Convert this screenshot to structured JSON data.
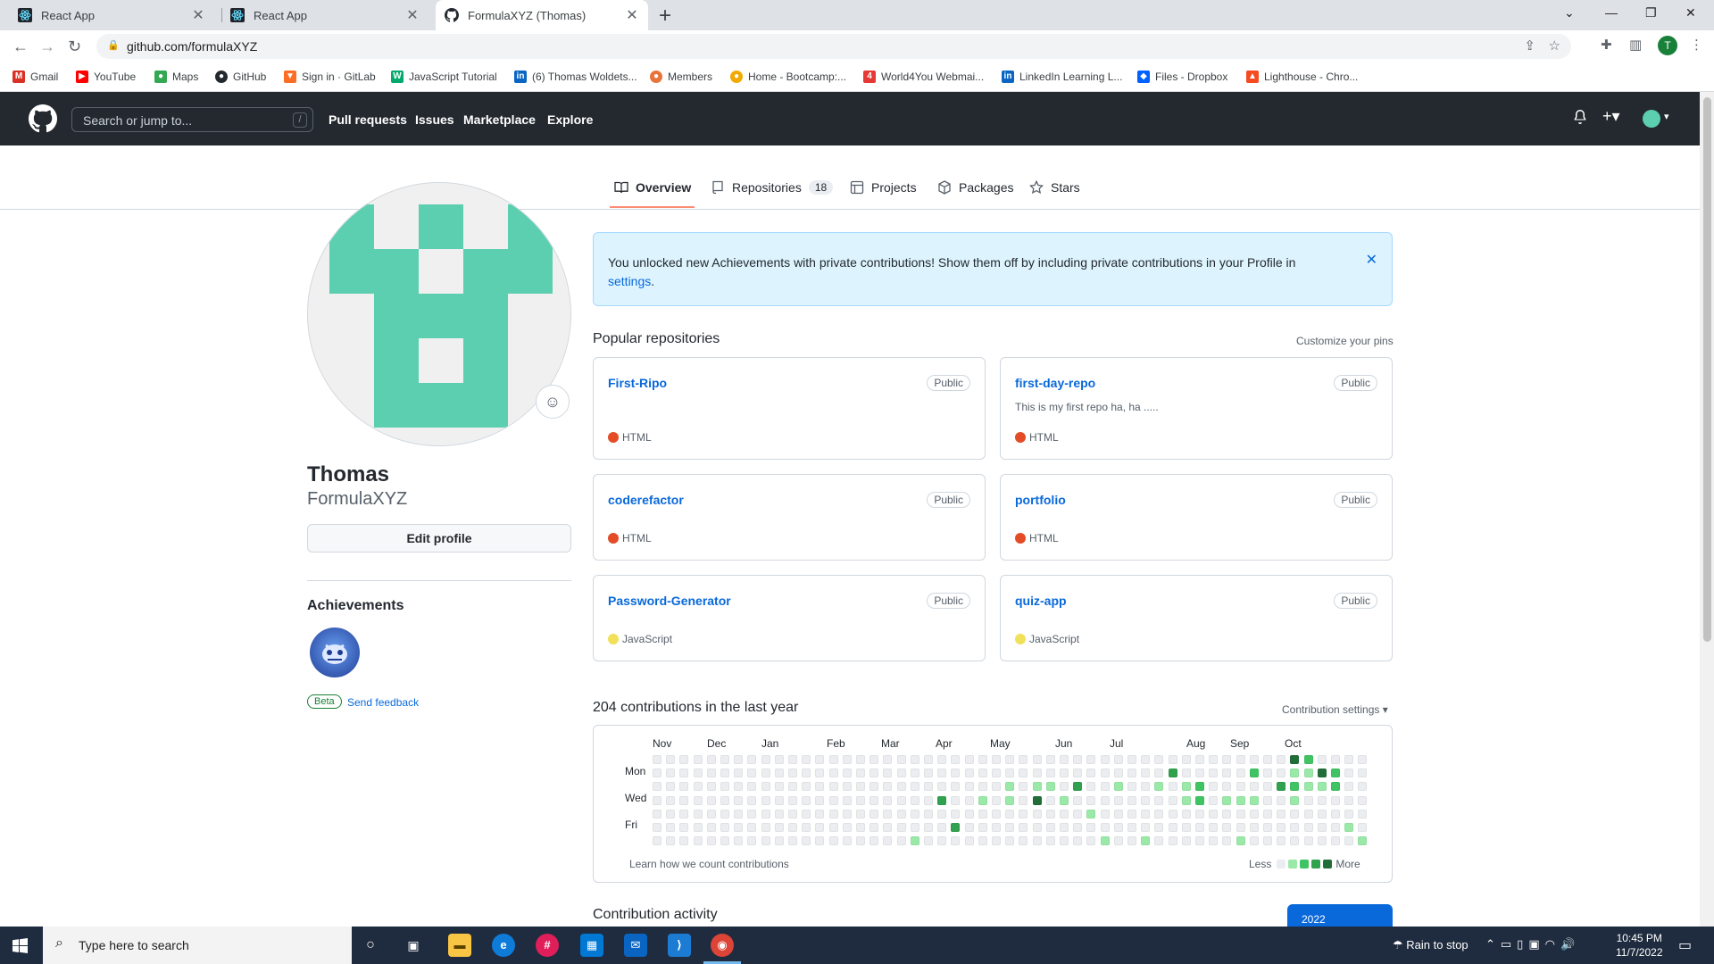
{
  "browser": {
    "tabs": [
      {
        "title": "React App",
        "active": false
      },
      {
        "title": "React App",
        "active": false
      },
      {
        "title": "FormulaXYZ (Thomas)",
        "active": true
      }
    ],
    "url": "github.com/formulaXYZ",
    "profile_initial": "T",
    "bookmarks": [
      {
        "label": "Gmail",
        "icon": "gmail-icon",
        "color": "#d93025"
      },
      {
        "label": "YouTube",
        "icon": "youtube-icon",
        "color": "#ff0000"
      },
      {
        "label": "Maps",
        "icon": "maps-icon",
        "color": "#34a853"
      },
      {
        "label": "GitHub",
        "icon": "github-icon",
        "color": "#24292f"
      },
      {
        "label": "Sign in · GitLab",
        "icon": "gitlab-icon",
        "color": "#fc6d26"
      },
      {
        "label": "JavaScript Tutorial",
        "icon": "w3schools-icon",
        "color": "#04aa6d"
      },
      {
        "label": "(6) Thomas Woldets...",
        "icon": "linkedin-icon",
        "color": "#0a66c2"
      },
      {
        "label": "Members",
        "icon": "members-icon",
        "color": "#e8743b"
      },
      {
        "label": "Home - Bootcamp:...",
        "icon": "bootcamp-icon",
        "color": "#f2a900"
      },
      {
        "label": "World4You Webmai...",
        "icon": "world4you-icon",
        "color": "#e53935"
      },
      {
        "label": "LinkedIn Learning L...",
        "icon": "linkedin-icon",
        "color": "#0a66c2"
      },
      {
        "label": "Files - Dropbox",
        "icon": "dropbox-icon",
        "color": "#0061fe"
      },
      {
        "label": "Lighthouse - Chro...",
        "icon": "lighthouse-icon",
        "color": "#f44b21"
      }
    ]
  },
  "github": {
    "search_placeholder": "Search or jump to...",
    "search_shortcut": "/",
    "nav": [
      "Pull requests",
      "Issues",
      "Marketplace",
      "Explore"
    ],
    "profile_tabs": {
      "overview": "Overview",
      "repositories": "Repositories",
      "repositories_count": "18",
      "projects": "Projects",
      "packages": "Packages",
      "stars": "Stars"
    },
    "profile": {
      "name": "Thomas",
      "login": "FormulaXYZ",
      "edit_button": "Edit profile",
      "achievements_title": "Achievements",
      "beta": "Beta",
      "feedback": "Send feedback",
      "avatar_color": "#5ccfb0"
    },
    "flash": {
      "text": "You unlocked new Achievements with private contributions! Show them off by including private contributions in your Profile in",
      "link": "settings",
      "period": "."
    },
    "popular": {
      "title": "Popular repositories",
      "customize": "Customize your pins",
      "repos": [
        {
          "name": "First-Ripo",
          "visibility": "Public",
          "description": "",
          "language": "HTML",
          "lang_color": "#e34c26"
        },
        {
          "name": "first-day-repo",
          "visibility": "Public",
          "description": "This is my first repo ha, ha .....",
          "language": "HTML",
          "lang_color": "#e34c26"
        },
        {
          "name": "coderefactor",
          "visibility": "Public",
          "description": "",
          "language": "HTML",
          "lang_color": "#e34c26"
        },
        {
          "name": "portfolio",
          "visibility": "Public",
          "description": "",
          "language": "HTML",
          "lang_color": "#e34c26"
        },
        {
          "name": "Password-Generator",
          "visibility": "Public",
          "description": "",
          "language": "JavaScript",
          "lang_color": "#f1e05a"
        },
        {
          "name": "quiz-app",
          "visibility": "Public",
          "description": "",
          "language": "JavaScript",
          "lang_color": "#f1e05a"
        }
      ]
    },
    "contributions": {
      "title": "204 contributions in the last year",
      "settings": "Contribution settings ▾",
      "months": [
        "Nov",
        "Dec",
        "Jan",
        "Feb",
        "Mar",
        "Apr",
        "May",
        "Jun",
        "Jul",
        "Aug",
        "Sep",
        "Oct"
      ],
      "days": [
        "Mon",
        "Wed",
        "Fri"
      ],
      "learn": "Learn how we count contributions",
      "less": "Less",
      "more": "More",
      "level_colors": [
        "#ebedf0",
        "#9be9a8",
        "#40c463",
        "#30a14e",
        "#216e39"
      ],
      "levels_by_week": [
        "0000000",
        "0000000",
        "0000000",
        "0000000",
        "0000000",
        "0000000",
        "0000000",
        "0000000",
        "0000000",
        "0000000",
        "0000000",
        "0000000",
        "0000000",
        "0000000",
        "0000000",
        "0000000",
        "0000000",
        "0000000",
        "0000000",
        "0000000",
        "0000000",
        "0000000",
        "0000000",
        "0000000",
        "0000000",
        "0000000",
        "0000000",
        "0000000",
        "0000000",
        "0000000",
        "0000001",
        "0000000",
        "0003000",
        "0000030",
        "0000000",
        "0001000",
        "0000000",
        "0000000",
        "0000000",
        "0000000",
        "0000000",
        "0100000",
        "0000000",
        "0000000",
        "0000000",
        "0000000",
        "0000000",
        "0000000",
        "0000000",
        "0000000",
        "0000000",
        "0000000",
        "0000000",
        "0000000",
        "0000000",
        "0000000",
        "0000000",
        "0000000",
        "0000000",
        "0000000",
        "0000000",
        "0000000",
        "0000000",
        "0000000",
        "0000000",
        "0000000",
        "0000000",
        "0000000",
        "0000000",
        "0000000",
        "0000000",
        "0000000",
        "0000000",
        "0000000",
        "0000000",
        "0000000",
        "0000000",
        "0000000",
        "0000000",
        "0000000",
        "0000000",
        "0000000",
        "0000000",
        "0000000",
        "0000000",
        "0000000",
        "0000000",
        "0000000",
        "0000000",
        "0000000",
        "0000000",
        "0000000",
        "0000000",
        "0000000",
        "0000000",
        "0000000",
        "0000000",
        "0000000",
        "0000000",
        "0000000",
        "0000000",
        "0000000",
        "0000000",
        "0000000",
        "0000000",
        "0000000",
        "0000000",
        "0000000",
        "0000000",
        "0000000",
        "0000000",
        "0000000",
        "0000000",
        "0000000",
        "0000000",
        "0000000",
        "0000000",
        "0000000",
        "0000000",
        "0000000",
        "0000000",
        "0000000",
        "0000000",
        "0000000",
        "0000000",
        "0000000",
        "0000000",
        "0000000",
        "0000000",
        "0000000",
        "0000000",
        "0000000",
        "0000000",
        "0000000",
        "0000000",
        "0000000",
        "0000000",
        "0000000",
        "0000000",
        "0000000",
        "0000000",
        "0000000",
        "0000000",
        "0000000",
        "0000000",
        "0000000",
        "0000000",
        "0000000",
        "0000000",
        "0000000",
        "0000000",
        "0000000",
        "0000000",
        "0000000",
        "0000000",
        "0000000",
        "0000000",
        "0000000",
        "0000000",
        "0000000",
        "0000000",
        "0000000",
        "0000000",
        "0000000",
        "0000000",
        "0000000",
        "0000000",
        "0000000",
        "0000000",
        "0000000",
        "0000000",
        "0000000",
        "0000000",
        "0000000",
        "0000000",
        "0000000",
        "0000000",
        "0000000",
        "0000000",
        "0000000",
        "0000000",
        "0000000",
        "0000000",
        "0000000",
        "0000000",
        "0000000",
        "0000000",
        "0000000",
        "0000000",
        "0000000",
        "0000000",
        "0000000",
        "0000000",
        "0000000",
        "0000000",
        "0000000",
        "0000000",
        "0000000",
        "0000000",
        "0000000",
        "0000000",
        "0000000",
        "0000000",
        "0000000",
        "0000000",
        "0000000",
        "0000000",
        "0000000",
        "0000000",
        "0000000",
        "0000000",
        "0000000",
        "0000000",
        "0000000",
        "0000000",
        "0000000",
        "0000000",
        "0000000",
        "0000000",
        "0000000",
        "0000000",
        "0000000",
        "0000000",
        "0000000",
        "0000000",
        "0000000",
        "0000000",
        "0000000",
        "0000000",
        "0000000",
        "0000000",
        "0000000",
        "0000000",
        "0000000",
        "0000000",
        "0000000",
        "0000000",
        "0000000",
        "0000000",
        "0000000",
        "0000000",
        "0000000",
        "0000000",
        "0000000",
        "0000000",
        "0000000",
        "0000000",
        "0000000",
        "0000000",
        "0000000",
        "0000000",
        "0000000",
        "0000000",
        "0000000",
        "0000000",
        "0000000",
        "0000000",
        "0000000",
        "0000000",
        "0000000",
        "0000000",
        "0000000",
        "0000000",
        "0000000",
        "0000000",
        "0000000",
        "0000000",
        "0000000",
        "0000000",
        "0000000",
        "0000000",
        "0000000",
        "0000000",
        "0000000",
        "0000000",
        "0000000",
        "0000000",
        "0000000",
        "0000000",
        "0000000",
        "0000000",
        "0000000",
        "0000000",
        "0000000",
        "0000000",
        "0000000",
        "0000000",
        "0000000",
        "0000000",
        "0000000",
        "0000000",
        "0000000",
        "0000000",
        "0000000",
        "0000000",
        "0000000",
        "0000000",
        "0000000",
        "0000000",
        "0000000",
        "0000000",
        "0000000",
        "0000000",
        "0000000",
        "0000000",
        "0000000",
        "0000000",
        "0000000",
        "0000000",
        "0000000",
        "0000000",
        "0000000",
        "0000000",
        "0000000",
        "0000000",
        "0000000",
        "0000000",
        "0000000",
        "0000000",
        "0000000",
        "0000000",
        "0000000",
        "0000000",
        "0000000",
        "0000000",
        "0000000",
        "0000000",
        "0000000",
        "0000000",
        "0000000",
        "0000000",
        "0000000",
        "0000000",
        "0000000",
        "0000000",
        "0000000",
        "0000000",
        "0000000",
        "0000000",
        "0000000",
        "0000000",
        "0000000",
        "0000000",
        "0000000",
        "0000000",
        "0000000",
        "0000000",
        "0000000",
        "0000000",
        "0000000",
        "0000000",
        "0000000",
        "0000000",
        "0000000",
        "0000000",
        "0000000",
        "0000000",
        "0000000",
        "0000000",
        "0000000",
        "0000000",
        "0000000",
        "0000000",
        "0000000",
        "0000000",
        "0000000",
        "0000000",
        "0000000",
        "0000000",
        "0000000",
        "0000000",
        "0000000",
        "0000000",
        "0000000",
        "0000000",
        "0000000",
        "0000000",
        "0000000",
        "0000000",
        "0000000",
        "0000000",
        "0000000",
        "0000000",
        "0000000",
        "0000000",
        "0000000",
        "0000000",
        "0000000",
        "0000000",
        "0000000",
        "0000000",
        "0000000",
        "0000000",
        "0000000",
        "0000000",
        "0000000",
        "0000000",
        "0000000",
        "0000000",
        "0000000",
        "0000000",
        "0000000",
        "0000000",
        "0000000",
        "0000000",
        "0000000",
        "0000000",
        "0000000",
        "0000000",
        "0000000",
        "0000000",
        "0000000",
        "0000000",
        "0000000",
        "0000000",
        "0000000",
        "0000000",
        "0000000",
        "0000000",
        "0000000",
        "0000000",
        "0000000",
        "0000000",
        "0000000",
        "0000000",
        "0000000",
        "0000000",
        "0000000",
        "0000000",
        "0000000",
        "0000000",
        "0000000",
        "0000000",
        "0000000",
        "0000000",
        "0000000",
        "0000000",
        "0000000",
        "0000000",
        "0000000",
        "0000000",
        "0000000",
        "0000000",
        "0000000",
        "0000000",
        "0000000",
        "0000000",
        "0000000",
        "0000000",
        "0000000",
        "0000000",
        "0000000",
        "0000000",
        "0000000",
        "0000000",
        "0000000",
        "0000000",
        "0000000",
        "0000000",
        "0000000",
        "0000000",
        "0000000",
        "0000000",
        "0000000",
        "0000000",
        "0000000",
        "0000000",
        "0000000",
        "0000000",
        "0000000",
        "0000000",
        "0000000",
        "0000000",
        "0000000",
        "0000000",
        "0000000",
        "0000000",
        "0000000",
        "0000000",
        "0000000",
        "0000000",
        "0000000",
        "0000000",
        "0000000",
        "0000000",
        "0000000",
        "0000000",
        "0000000",
        "0000000",
        "0000000",
        "0000000",
        "0000000",
        "0000000",
        "0000000",
        "0000000",
        "0000000",
        "0000000",
        "0000000",
        "0000000",
        "0000000",
        "0000000",
        "0000000",
        "0000000",
        "0000000",
        "0000000",
        "0000000",
        "0000000",
        "0000000",
        "0000000",
        "0000000",
        "0000000",
        "0000000",
        "0000000"
      ],
      "active_weeks": [
        "0000000",
        "0000000",
        "0000000",
        "0000000",
        "0000000",
        "0000000",
        "0000000",
        "0000000",
        "0000000",
        "0000000",
        "0000000",
        "0000000",
        "0000000",
        "0000000",
        "0000000",
        "0000000",
        "0000000",
        "0000000",
        "0000000",
        "0000000",
        "0000000",
        "0000000",
        "0000000",
        "0000000",
        "0000000",
        "0000000",
        "0000000",
        "0000000",
        "0000000",
        "0000000",
        "0000001",
        "0000000",
        "0003000",
        "0000030",
        "0000000",
        "0001000",
        "0000000",
        "0011000",
        "0000000",
        "0014000",
        "0010000",
        "0001000",
        "0030000",
        "0000100",
        "0000001",
        "0010000",
        "0000000",
        "0000001",
        "0010000",
        "0300000",
        "0011000",
        "0022000",
        "0000000",
        "0001000",
        "0001001",
        "0201000",
        "0000000",
        "0030000",
        "4121000",
        "2110000",
        "0410000",
        "0220000",
        "0000010",
        "0000001"
      ]
    },
    "activity": {
      "title": "Contribution activity",
      "year": "2022"
    }
  },
  "taskbar": {
    "search_placeholder": "Type here to search",
    "weather": "Rain to stop",
    "time": "10:45 PM",
    "date": "11/7/2022"
  }
}
